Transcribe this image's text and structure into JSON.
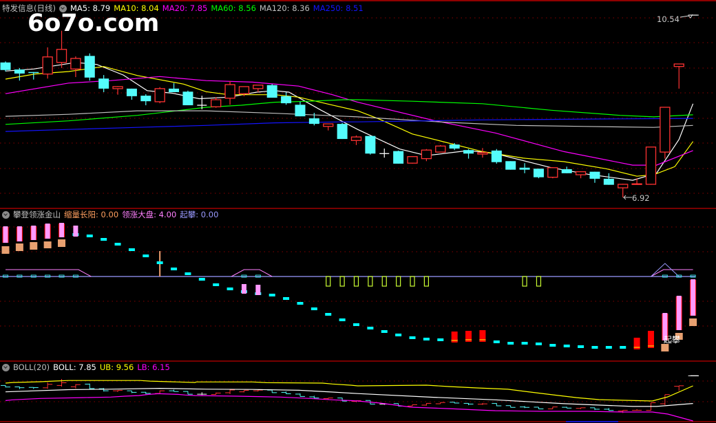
{
  "header": {
    "security": "特发信息(日线)",
    "ma": [
      {
        "label": "MA5: 8.79",
        "color": "#ffffff"
      },
      {
        "label": "MA10: 8.04",
        "color": "#ffff00"
      },
      {
        "label": "MA20: 7.85",
        "color": "#ff00ff"
      },
      {
        "label": "MA60: 8.56",
        "color": "#00ff00"
      },
      {
        "label": "MA120: 8.36",
        "color": "#c0c0c0"
      },
      {
        "label": "MA250: 8.51",
        "color": "#1414ff"
      }
    ]
  },
  "watermark": "6o7o.com",
  "indicator_header": {
    "name": "攀登领涨金山",
    "items": [
      {
        "label": "缩量长阳: 0.00",
        "color": "#ff9f5f"
      },
      {
        "label": "领涨大盘: 4.00",
        "color": "#ff80ff"
      },
      {
        "label": "起攀: 0.00",
        "color": "#9a9aff"
      }
    ]
  },
  "boll_header": {
    "name": "BOLL(20)",
    "items": [
      {
        "label": "BOLL: 7.85",
        "color": "#ffffff"
      },
      {
        "label": "UB: 9.56",
        "color": "#ffff00"
      },
      {
        "label": "LB: 6.15",
        "color": "#ff00ff"
      }
    ]
  },
  "annotations": {
    "high_label": "10.54",
    "low_label": "6.92",
    "signal_label": "起攀"
  },
  "colors": {
    "up": "#ff3232",
    "down": "#54fcfc",
    "flat": "#ffffff",
    "grid": "#8b0000",
    "border": "#c00000"
  },
  "chart_data": {
    "type": "candlestick",
    "title": "特发信息(日线)",
    "high": 10.54,
    "low": 6.92,
    "candles_ohlc": [
      [
        9.6,
        9.62,
        9.42,
        9.45
      ],
      [
        9.46,
        9.49,
        9.24,
        9.38
      ],
      [
        9.41,
        9.41,
        9.26,
        9.39
      ],
      [
        9.37,
        9.9,
        9.28,
        9.71
      ],
      [
        9.6,
        10.23,
        9.49,
        9.86
      ],
      [
        9.47,
        9.72,
        9.31,
        9.68
      ],
      [
        9.73,
        9.78,
        9.24,
        9.3
      ],
      [
        9.28,
        9.35,
        9.01,
        9.08
      ],
      [
        9.08,
        9.13,
        8.96,
        9.12
      ],
      [
        9.08,
        9.08,
        8.86,
        8.93
      ],
      [
        8.94,
        8.97,
        8.75,
        8.83
      ],
      [
        8.82,
        9.11,
        8.79,
        9.08
      ],
      [
        9.08,
        9.19,
        9.01,
        9.01
      ],
      [
        9.02,
        9.04,
        8.75,
        8.75
      ],
      [
        8.75,
        8.94,
        8.67,
        8.75
      ],
      [
        8.72,
        8.91,
        8.7,
        8.86
      ],
      [
        8.89,
        9.23,
        8.76,
        9.16
      ],
      [
        8.98,
        9.12,
        8.93,
        9.12
      ],
      [
        9.08,
        9.15,
        9.01,
        9.15
      ],
      [
        9.15,
        9.17,
        8.9,
        8.9
      ],
      [
        8.93,
        9.01,
        8.76,
        8.79
      ],
      [
        8.76,
        8.82,
        8.53,
        8.53
      ],
      [
        8.49,
        8.6,
        8.35,
        8.38
      ],
      [
        8.33,
        8.38,
        8.25,
        8.38
      ],
      [
        8.38,
        8.4,
        8.08,
        8.08
      ],
      [
        8.05,
        8.15,
        7.96,
        8.12
      ],
      [
        8.14,
        8.14,
        7.77,
        7.79
      ],
      [
        7.79,
        7.89,
        7.71,
        7.79
      ],
      [
        7.84,
        7.85,
        7.59,
        7.59
      ],
      [
        7.6,
        7.74,
        7.59,
        7.73
      ],
      [
        7.69,
        7.88,
        7.64,
        7.86
      ],
      [
        7.82,
        7.96,
        7.82,
        7.94
      ],
      [
        7.97,
        8.0,
        7.86,
        7.89
      ],
      [
        7.86,
        7.88,
        7.69,
        7.79
      ],
      [
        7.78,
        7.9,
        7.71,
        7.81
      ],
      [
        7.85,
        7.88,
        7.59,
        7.62
      ],
      [
        7.64,
        7.64,
        7.47,
        7.47
      ],
      [
        7.51,
        7.6,
        7.4,
        7.47
      ],
      [
        7.49,
        7.49,
        7.3,
        7.32
      ],
      [
        7.32,
        7.52,
        7.3,
        7.51
      ],
      [
        7.48,
        7.53,
        7.4,
        7.4
      ],
      [
        7.37,
        7.44,
        7.3,
        7.43
      ],
      [
        7.43,
        7.43,
        7.21,
        7.29
      ],
      [
        7.29,
        7.4,
        7.17,
        7.17
      ],
      [
        7.11,
        7.19,
        6.92,
        7.18
      ],
      [
        7.18,
        7.3,
        7.17,
        7.19
      ],
      [
        7.18,
        7.92,
        7.17,
        7.92
      ],
      [
        7.82,
        8.71,
        7.69,
        8.71
      ],
      [
        9.52,
        9.57,
        9.08,
        9.57
      ],
      [
        10.54,
        10.54,
        10.54,
        10.54
      ]
    ],
    "ma_series": [
      {
        "name": "MA5",
        "color": "#ffffff",
        "points": [
          [
            0,
            9.43
          ],
          [
            2,
            9.47
          ],
          [
            5,
            9.6
          ],
          [
            6.5,
            9.56
          ],
          [
            8.4,
            9.35
          ],
          [
            10.1,
            9.04
          ],
          [
            11.9,
            8.99
          ],
          [
            13.8,
            8.88
          ],
          [
            15.9,
            8.91
          ],
          [
            17.9,
            9.01
          ],
          [
            19.2,
            9.04
          ],
          [
            20.2,
            9.01
          ],
          [
            22.5,
            8.65
          ],
          [
            25.1,
            8.27
          ],
          [
            28.1,
            7.88
          ],
          [
            30,
            7.75
          ],
          [
            33,
            7.85
          ],
          [
            34.9,
            7.79
          ],
          [
            38.9,
            7.51
          ],
          [
            41.5,
            7.38
          ],
          [
            44.7,
            7.26
          ],
          [
            46.4,
            7.4
          ],
          [
            48,
            8.07
          ],
          [
            49,
            8.78
          ]
        ]
      },
      {
        "name": "MA10",
        "color": "#ffff00",
        "points": [
          [
            0,
            9.27
          ],
          [
            2.1,
            9.37
          ],
          [
            4.5,
            9.42
          ],
          [
            7,
            9.52
          ],
          [
            9.4,
            9.34
          ],
          [
            12.7,
            9.17
          ],
          [
            14.3,
            9.02
          ],
          [
            15.9,
            8.96
          ],
          [
            19.2,
            8.96
          ],
          [
            20.9,
            8.91
          ],
          [
            23.2,
            8.76
          ],
          [
            25.1,
            8.64
          ],
          [
            26.6,
            8.48
          ],
          [
            29,
            8.18
          ],
          [
            31,
            8.04
          ],
          [
            34,
            7.83
          ],
          [
            36.9,
            7.7
          ],
          [
            39.8,
            7.63
          ],
          [
            42.8,
            7.49
          ],
          [
            45,
            7.34
          ],
          [
            46.2,
            7.37
          ],
          [
            47.7,
            7.53
          ],
          [
            49,
            8.03
          ]
        ]
      },
      {
        "name": "MA20",
        "color": "#ff00ff",
        "points": [
          [
            0,
            8.98
          ],
          [
            4.5,
            9.19
          ],
          [
            7.5,
            9.24
          ],
          [
            11,
            9.32
          ],
          [
            14.3,
            9.24
          ],
          [
            17.6,
            9.21
          ],
          [
            20.9,
            9.13
          ],
          [
            23.3,
            8.96
          ],
          [
            25.1,
            8.81
          ],
          [
            30.5,
            8.45
          ],
          [
            34.9,
            8.2
          ],
          [
            39.8,
            7.83
          ],
          [
            44.7,
            7.56
          ],
          [
            46.4,
            7.56
          ],
          [
            49,
            7.85
          ]
        ]
      },
      {
        "name": "MA60",
        "color": "#00ff00",
        "points": [
          [
            0,
            8.37
          ],
          [
            4.5,
            8.44
          ],
          [
            9.4,
            8.55
          ],
          [
            11.9,
            8.63
          ],
          [
            14.3,
            8.71
          ],
          [
            16.8,
            8.75
          ],
          [
            19.2,
            8.81
          ],
          [
            21.7,
            8.83
          ],
          [
            24.1,
            8.86
          ],
          [
            25.1,
            8.86
          ],
          [
            29,
            8.83
          ],
          [
            34,
            8.78
          ],
          [
            38.9,
            8.65
          ],
          [
            43.8,
            8.55
          ],
          [
            46.2,
            8.52
          ],
          [
            49,
            8.56
          ]
        ]
      },
      {
        "name": "MA120",
        "color": "#c0c0c0",
        "points": [
          [
            0,
            8.53
          ],
          [
            4.5,
            8.57
          ],
          [
            9.4,
            8.64
          ],
          [
            14.3,
            8.64
          ],
          [
            19.2,
            8.59
          ],
          [
            22.7,
            8.55
          ],
          [
            25.1,
            8.52
          ],
          [
            31.5,
            8.41
          ],
          [
            36.4,
            8.35
          ],
          [
            41.3,
            8.33
          ],
          [
            46.2,
            8.31
          ],
          [
            49,
            8.35
          ]
        ]
      },
      {
        "name": "MA250",
        "color": "#1414ff",
        "points": [
          [
            0,
            8.23
          ],
          [
            4.5,
            8.27
          ],
          [
            9.4,
            8.31
          ],
          [
            14.3,
            8.35
          ],
          [
            19.2,
            8.4
          ],
          [
            24.1,
            8.42
          ],
          [
            25.1,
            8.42
          ],
          [
            34,
            8.46
          ],
          [
            43.8,
            8.48
          ],
          [
            49,
            8.49
          ]
        ]
      }
    ],
    "indicator": {
      "cyan_dash": [
        [
          5,
          6.1
        ],
        [
          6,
          5.9
        ],
        [
          7,
          5.4
        ],
        [
          8,
          4.7
        ],
        [
          9,
          3.9
        ],
        [
          10,
          3.0
        ],
        [
          11,
          2.0
        ],
        [
          12,
          1.1
        ],
        [
          13,
          0.4
        ],
        [
          14,
          -0.4
        ],
        [
          15,
          -1.2
        ],
        [
          16,
          -1.8
        ],
        [
          17,
          -2.2
        ],
        [
          18,
          -2.5
        ],
        [
          19,
          -2.7
        ],
        [
          20,
          -3.2
        ],
        [
          21,
          -3.9
        ],
        [
          22,
          -4.7
        ],
        [
          23,
          -5.5
        ],
        [
          24,
          -6.3
        ],
        [
          25,
          -7.0
        ],
        [
          26,
          -7.5
        ],
        [
          27,
          -8.0
        ],
        [
          28,
          -8.5
        ],
        [
          29,
          -8.9
        ],
        [
          30,
          -9.1
        ],
        [
          31,
          -9.2
        ],
        [
          32,
          -9.3
        ],
        [
          33,
          -9.3
        ],
        [
          34,
          -9.3
        ],
        [
          35,
          -9.5
        ],
        [
          36,
          -9.7
        ],
        [
          37,
          -9.7
        ],
        [
          38,
          -9.8
        ],
        [
          39,
          -10.0
        ],
        [
          40,
          -10.1
        ],
        [
          41,
          -10.2
        ],
        [
          42,
          -10.3
        ],
        [
          43,
          -10.3
        ],
        [
          44,
          -10.3
        ]
      ],
      "pink_bars": [
        [
          0,
          7.3,
          4.9,
          1
        ],
        [
          1,
          7.3,
          5.1,
          1
        ],
        [
          2,
          7.4,
          5.3,
          1
        ],
        [
          3,
          7.7,
          5.5,
          1
        ],
        [
          4,
          7.8,
          5.7,
          1
        ],
        [
          5,
          7.4,
          5.8,
          0
        ],
        [
          17,
          -1.1,
          -2.5,
          0
        ],
        [
          18,
          -1.2,
          -2.7,
          0
        ],
        [
          47,
          -5.3,
          -9.3,
          1
        ],
        [
          48,
          -2.8,
          -7.8,
          1
        ],
        [
          49,
          -0.4,
          -5.7,
          1
        ]
      ],
      "orange_blocks": [
        [
          0,
          4.4,
          3.3
        ],
        [
          1,
          4.8,
          3.7
        ],
        [
          2,
          5.0,
          3.9
        ],
        [
          3,
          5.1,
          4.1
        ],
        [
          4,
          5.4,
          4.3
        ],
        [
          47,
          -9.8,
          -10.9
        ],
        [
          48,
          -8.2,
          -9.2
        ],
        [
          49,
          -6.1,
          -7.2
        ]
      ],
      "red_blocks": [
        [
          32,
          -8.0,
          -9.6
        ],
        [
          33,
          -7.9,
          -9.5
        ],
        [
          34,
          -7.8,
          -9.5
        ],
        [
          45,
          -8.9,
          -10.6
        ],
        [
          46,
          -7.9,
          -10.4
        ]
      ],
      "yellow_boxes": [
        23,
        24,
        25,
        26,
        27,
        28,
        29,
        30,
        37,
        38
      ],
      "orange_spike": [
        11,
        3.7
      ],
      "baseline_marks": [
        0,
        1,
        2,
        3,
        4,
        5,
        17,
        18,
        47,
        48,
        49
      ],
      "plateaus": [
        [
          [
            0,
            1.0
          ],
          [
            5.2,
            1.0
          ],
          [
            6.1,
            0
          ]
        ],
        [
          [
            16.1,
            0
          ],
          [
            17,
            1.0
          ],
          [
            18.1,
            1.0
          ],
          [
            19,
            0
          ]
        ],
        [
          [
            46,
            0
          ],
          [
            46.9,
            1.0
          ],
          [
            49,
            1.0
          ]
        ]
      ],
      "triangle": [
        [
          46,
          0
        ],
        [
          47,
          1.9
        ],
        [
          48,
          0
        ]
      ],
      "signal_at": [
        47.6,
        -9.0
      ]
    },
    "boll": {
      "mid": "MA20",
      "ub": [
        [
          0,
          9.83
        ],
        [
          0.5,
          9.89
        ],
        [
          2.5,
          9.96
        ],
        [
          3.5,
          10.03
        ],
        [
          4.5,
          10.08
        ],
        [
          9.6,
          10.08
        ],
        [
          10.3,
          10.02
        ],
        [
          13.5,
          9.89
        ],
        [
          13.6,
          9.94
        ],
        [
          17.6,
          9.94
        ],
        [
          18.6,
          9.87
        ],
        [
          22.6,
          9.83
        ],
        [
          23.3,
          9.74
        ],
        [
          24.6,
          9.63
        ],
        [
          25.1,
          9.56
        ],
        [
          30,
          9.63
        ],
        [
          31.6,
          9.49
        ],
        [
          33.6,
          9.36
        ],
        [
          35.8,
          9.23
        ],
        [
          37.4,
          8.96
        ],
        [
          39,
          8.69
        ],
        [
          40.7,
          8.42
        ],
        [
          42.3,
          8.22
        ],
        [
          43.9,
          8.16
        ],
        [
          46.1,
          8.09
        ],
        [
          47.2,
          8.49
        ],
        [
          49,
          9.56
        ]
      ],
      "lb": [
        [
          0,
          8.13
        ],
        [
          0.5,
          8.2
        ],
        [
          1.5,
          8.27
        ],
        [
          2.5,
          8.34
        ],
        [
          5.5,
          8.42
        ],
        [
          7.5,
          8.47
        ],
        [
          8.5,
          8.56
        ],
        [
          9.5,
          8.62
        ],
        [
          10.2,
          8.73
        ],
        [
          10.9,
          8.8
        ],
        [
          12.3,
          8.73
        ],
        [
          12.8,
          8.67
        ],
        [
          13.5,
          8.62
        ],
        [
          16.5,
          8.56
        ],
        [
          19.6,
          8.47
        ],
        [
          21.7,
          8.34
        ],
        [
          23.3,
          8.2
        ],
        [
          24.6,
          8.13
        ],
        [
          25.1,
          8.09
        ],
        [
          26.7,
          7.89
        ],
        [
          28.9,
          7.49
        ],
        [
          31.6,
          7.35
        ],
        [
          34.9,
          7.15
        ],
        [
          38.2,
          7.09
        ],
        [
          41.5,
          7.09
        ],
        [
          43.9,
          7.02
        ],
        [
          46.1,
          7.02
        ],
        [
          47.2,
          6.82
        ],
        [
          49,
          6.15
        ]
      ]
    }
  }
}
